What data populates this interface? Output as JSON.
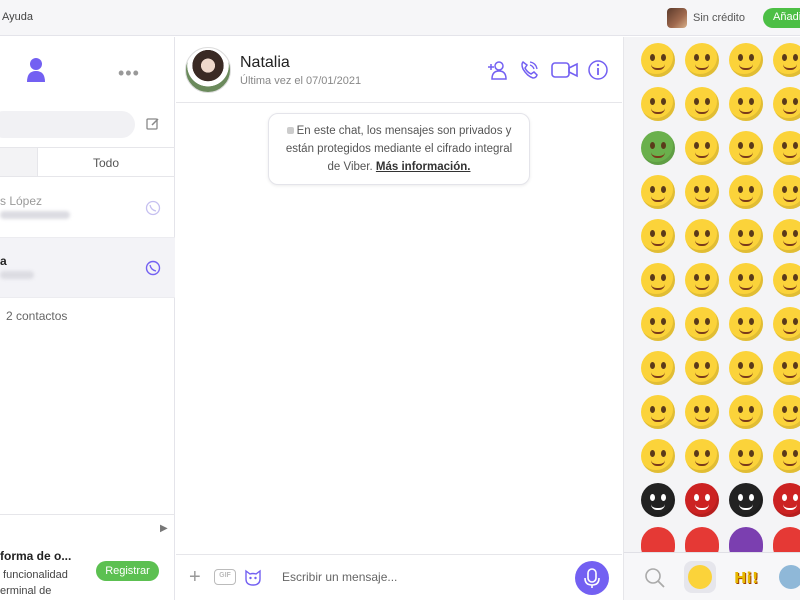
{
  "topbar": {
    "help_menu": "Ayuda",
    "credit_label": "Sin crédito",
    "add_button": "Añadir"
  },
  "left": {
    "tab_all": "Todo",
    "chats": [
      {
        "name": "s López"
      },
      {
        "name": "a"
      }
    ],
    "contacts_count": "2 contactos",
    "promo": {
      "title": "forma de o...",
      "text": " funcionalidad\nerminal de",
      "register": "Registrar"
    }
  },
  "chat": {
    "contact_name": "Natalia",
    "last_seen": "Última vez el 07/01/2021",
    "notice_text": "En este chat, los mensajes son privados y están protegidos mediante el cifrado integral de Viber.",
    "notice_link": "Más información.",
    "composer_placeholder": "Escribir un mensaje...",
    "gif_label": "GIF"
  },
  "colors": {
    "viber_purple": "#7360f2",
    "green": "#4cbf45",
    "emoji_yellow": "#fbd33a"
  },
  "icons": [
    "person-icon",
    "more-icon",
    "compose-icon",
    "viber-icon",
    "add-participant-icon",
    "call-icon",
    "video-icon",
    "info-icon",
    "plus-icon",
    "gif-icon",
    "sticker-icon",
    "mic-icon",
    "search-icon",
    "emoji-tab-icon",
    "stickers-tab-icon"
  ]
}
